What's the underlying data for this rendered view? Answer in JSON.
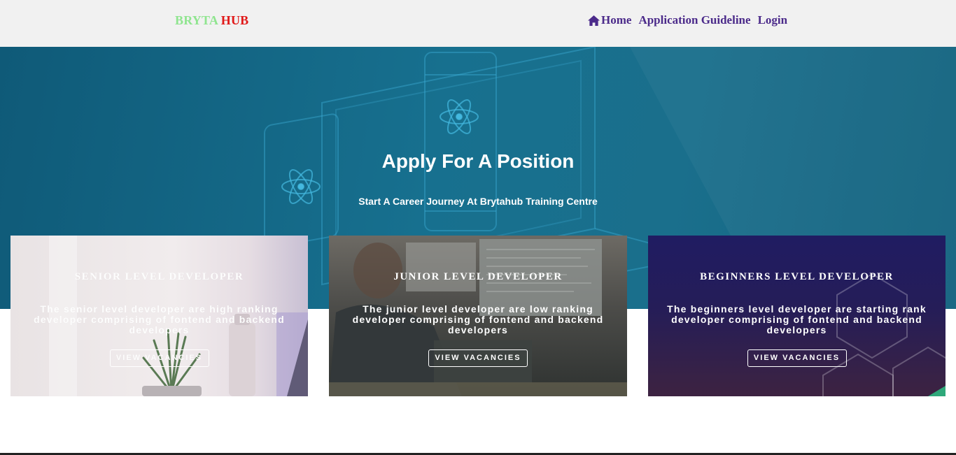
{
  "header": {
    "brand_part1": "BRYTA",
    "brand_part2": "HUB",
    "nav": {
      "home": "Home",
      "guideline": "Application Guideline",
      "login": "Login"
    }
  },
  "hero": {
    "title": "Apply For A Position",
    "subtitle": "Start A Career Journey At Brytahub Training Centre"
  },
  "cards": [
    {
      "title": "SENIOR LEVEL DEVELOPER",
      "description": "The senior level developer are high ranking developer comprising of fontend and backend developers",
      "button": "VIEW VACANCIES"
    },
    {
      "title": "JUNIOR LEVEL DEVELOPER",
      "description": "The junior level developer are low ranking developer comprising of fontend and backend developers",
      "button": "VIEW VACANCIES"
    },
    {
      "title": "BEGINNERS LEVEL DEVELOPER",
      "description": "The beginners level developer are starting rank developer comprising of fontend and backend developers",
      "button": "VIEW VACANCIES"
    }
  ],
  "colors": {
    "brand_green": "#8fe58f",
    "brand_red": "#e01818",
    "nav_purple": "#4b2a8a",
    "hero_blue": "#17708f"
  },
  "icons": {
    "home": "home-icon"
  }
}
